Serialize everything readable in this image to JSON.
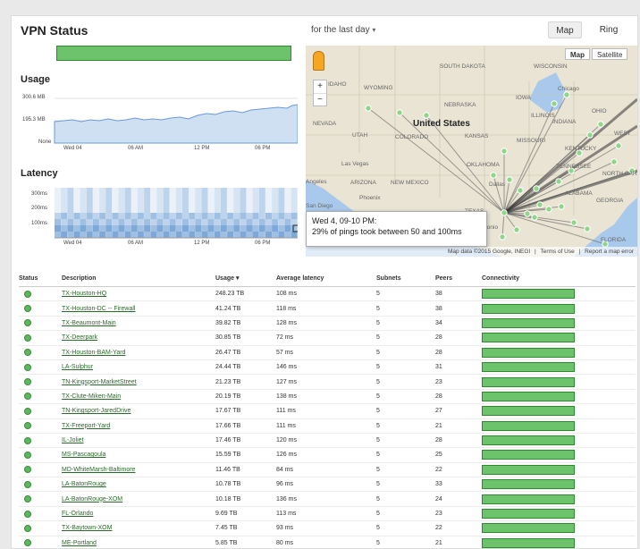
{
  "title": "VPN Status",
  "period": "for the last day",
  "view_buttons": {
    "map": "Map",
    "ring": "Ring"
  },
  "usage": {
    "title": "Usage",
    "ticks": [
      "300.6 MB",
      "195.3 MB",
      "None"
    ],
    "x_ticks": [
      "Wed 04",
      "06 AM",
      "12 PM",
      "06 PM"
    ]
  },
  "latency": {
    "title": "Latency",
    "ticks": [
      "300ms",
      "200ms",
      "100ms"
    ],
    "x_ticks": [
      "Wed 04",
      "06 AM",
      "12 PM",
      "06 PM"
    ]
  },
  "map": {
    "map_btn": "Map",
    "satellite_btn": "Satellite",
    "attribution": "Map data ©2015 Google, INEGI",
    "terms": "Terms of Use",
    "report": "Report a map error",
    "labels": [
      "WISCONSIN",
      "SOUTH DAKOTA",
      "IDAHO",
      "WYOMING",
      "NEBRASKA",
      "IOWA",
      "Chicago",
      "ILLINOIS",
      "INDIANA",
      "OHIO",
      "NEVADA",
      "UTAH",
      "United States",
      "COLORADO",
      "KANSAS",
      "MISSOURI",
      "KENTUCKY",
      "Las Vegas",
      "OKLAHOMA",
      "TENNESSEE",
      "Angeles",
      "ARIZONA",
      "NEW MEXICO",
      "Phoenix",
      "Dallas",
      "ALABAMA",
      "GEORGIA",
      "San Diego",
      "TEXAS",
      "San Antonio",
      "FLORIDA",
      "NORTH CAROLINA",
      "WEST"
    ]
  },
  "tooltip": {
    "line1": "Wed 4, 09-10 PM:",
    "line2": "29% of pings took between 50 and 100ms"
  },
  "table": {
    "headers": [
      "Status",
      "Description",
      "Usage ▾",
      "Average latency",
      "Subnets",
      "Peers",
      "Connectivity"
    ],
    "rows": [
      {
        "desc": "TX-Houston-HQ",
        "usage": "248.23 TB",
        "latency": "108 ms",
        "subnets": "5",
        "peers": "38"
      },
      {
        "desc": "TX-Houston-DC -- Firewall",
        "usage": "41.24 TB",
        "latency": "118 ms",
        "subnets": "5",
        "peers": "38"
      },
      {
        "desc": "TX-Beaumont-Main",
        "usage": "39.82 TB",
        "latency": "128 ms",
        "subnets": "5",
        "peers": "34"
      },
      {
        "desc": "TX-Deerpark",
        "usage": "30.85 TB",
        "latency": "72 ms",
        "subnets": "5",
        "peers": "28"
      },
      {
        "desc": "TX-Houston-BAM-Yard",
        "usage": "26.47 TB",
        "latency": "57 ms",
        "subnets": "5",
        "peers": "28"
      },
      {
        "desc": "LA-Sulphur",
        "usage": "24.44 TB",
        "latency": "146 ms",
        "subnets": "5",
        "peers": "31"
      },
      {
        "desc": "TN-Kingsport-MarketStreet",
        "usage": "21.23 TB",
        "latency": "127 ms",
        "subnets": "5",
        "peers": "23"
      },
      {
        "desc": "TX-Clute-Miken-Main",
        "usage": "20.19 TB",
        "latency": "138 ms",
        "subnets": "5",
        "peers": "28"
      },
      {
        "desc": "TN-Kingsport-JaredDrive",
        "usage": "17.67 TB",
        "latency": "111 ms",
        "subnets": "5",
        "peers": "27"
      },
      {
        "desc": "TX-Freeport-Yard",
        "usage": "17.66 TB",
        "latency": "111 ms",
        "subnets": "5",
        "peers": "21"
      },
      {
        "desc": "IL-Joliet",
        "usage": "17.46 TB",
        "latency": "120 ms",
        "subnets": "5",
        "peers": "28"
      },
      {
        "desc": "MS-Pascagoula",
        "usage": "15.59 TB",
        "latency": "126 ms",
        "subnets": "5",
        "peers": "25"
      },
      {
        "desc": "MD-WhiteMarsh-Baltimore",
        "usage": "11.46 TB",
        "latency": "84 ms",
        "subnets": "5",
        "peers": "22"
      },
      {
        "desc": "LA-BatonRouge",
        "usage": "10.78 TB",
        "latency": "96 ms",
        "subnets": "5",
        "peers": "33"
      },
      {
        "desc": "LA-BatonRouge-XOM",
        "usage": "10.18 TB",
        "latency": "136 ms",
        "subnets": "5",
        "peers": "24"
      },
      {
        "desc": "FL-Orlando",
        "usage": "9.69 TB",
        "latency": "113 ms",
        "subnets": "5",
        "peers": "23"
      },
      {
        "desc": "TX-Baytown-XOM",
        "usage": "7.45 TB",
        "latency": "93 ms",
        "subnets": "5",
        "peers": "22"
      },
      {
        "desc": "ME-Portland",
        "usage": "5.85 TB",
        "latency": "80 ms",
        "subnets": "5",
        "peers": "21"
      }
    ]
  },
  "colors": {
    "status_green": "#5cb85c",
    "bar_green": "#6cc36c",
    "chart_blue": "#6a9ad8"
  }
}
